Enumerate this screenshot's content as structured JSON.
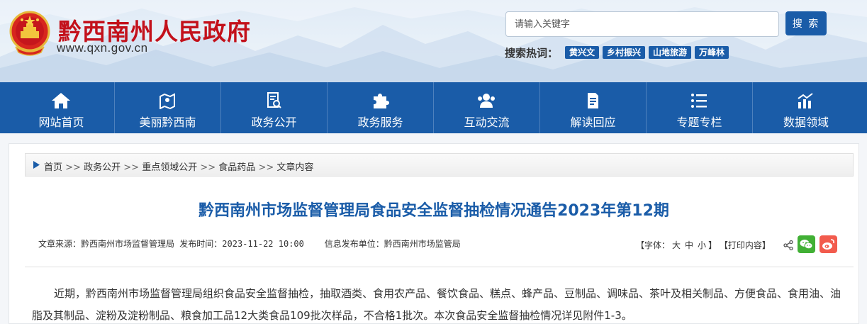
{
  "header": {
    "site_name": "黔西南州人民政府",
    "site_url": "www.qxn.gov.cn",
    "search_placeholder": "请输入关键字",
    "search_button": "搜 索",
    "hot_label": "搜索热词：",
    "hot_tags": [
      "黄兴文",
      "乡村振兴",
      "山地旅游",
      "万峰林"
    ]
  },
  "nav": {
    "items": [
      {
        "label": "网站首页",
        "icon": "home-icon"
      },
      {
        "label": "美丽黔西南",
        "icon": "map-icon"
      },
      {
        "label": "政务公开",
        "icon": "document-search-icon"
      },
      {
        "label": "政务服务",
        "icon": "puzzle-icon"
      },
      {
        "label": "互动交流",
        "icon": "people-icon"
      },
      {
        "label": "解读回应",
        "icon": "file-icon"
      },
      {
        "label": "专题专栏",
        "icon": "list-icon"
      },
      {
        "label": "数据领域",
        "icon": "chart-icon"
      }
    ]
  },
  "breadcrumb": {
    "items": [
      "首页",
      "政务公开",
      "重点领域公开",
      "食品药品",
      "文章内容"
    ],
    "separator": ">>"
  },
  "article": {
    "title": "黔西南州市场监督管理局食品安全监督抽检情况通告2023年第12期",
    "source_label": "文章来源：",
    "source": "黔西南州市场监督管理局",
    "time_label": "发布时间：",
    "time": "2023-11-22 10:00",
    "publisher_label": "信息发布单位：",
    "publisher": "黔西南州市场监管局",
    "font_label": "【字体：",
    "font_large": "大",
    "font_medium": "中",
    "font_small": "小",
    "font_close": "】",
    "print_label": "【打印内容】",
    "body": "近期，黔西南州市场监督管理局组织食品安全监督抽检，抽取酒类、食用农产品、餐饮食品、糕点、蜂产品、豆制品、调味品、茶叶及相关制品、方便食品、食用油、油脂及其制品、淀粉及淀粉制品、粮食加工品12大类食品109批次样品，不合格1批次。本次食品安全监督抽检情况详见附件1-3。"
  },
  "colors": {
    "brand_red": "#c3111b",
    "nav_blue": "#1a5ca8",
    "wechat_green": "#41b035",
    "weibo_red": "#f25b4d"
  }
}
